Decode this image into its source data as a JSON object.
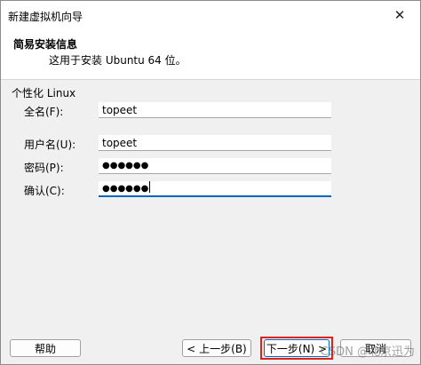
{
  "window": {
    "title": "新建虚拟机向导",
    "close_glyph": "✕"
  },
  "header": {
    "title": "简易安装信息",
    "subtitle": "这用于安装 Ubuntu 64 位。"
  },
  "group": {
    "label": "个性化 Linux"
  },
  "fields": {
    "fullname": {
      "label": "全名(F):",
      "value": "topeet"
    },
    "username": {
      "label": "用户名(U):",
      "value": "topeet"
    },
    "password": {
      "label": "密码(P):",
      "value": "●●●●●●"
    },
    "confirm": {
      "label": "确认(C):",
      "value": "●●●●●●"
    }
  },
  "buttons": {
    "help": "帮助",
    "back": "< 上一步(B)",
    "next": "下一步(N) >",
    "cancel": "取消"
  },
  "watermark": "CSDN @北京迅为",
  "colors": {
    "highlight_border": "#e0201b",
    "focus_underline": "#0067c0"
  }
}
